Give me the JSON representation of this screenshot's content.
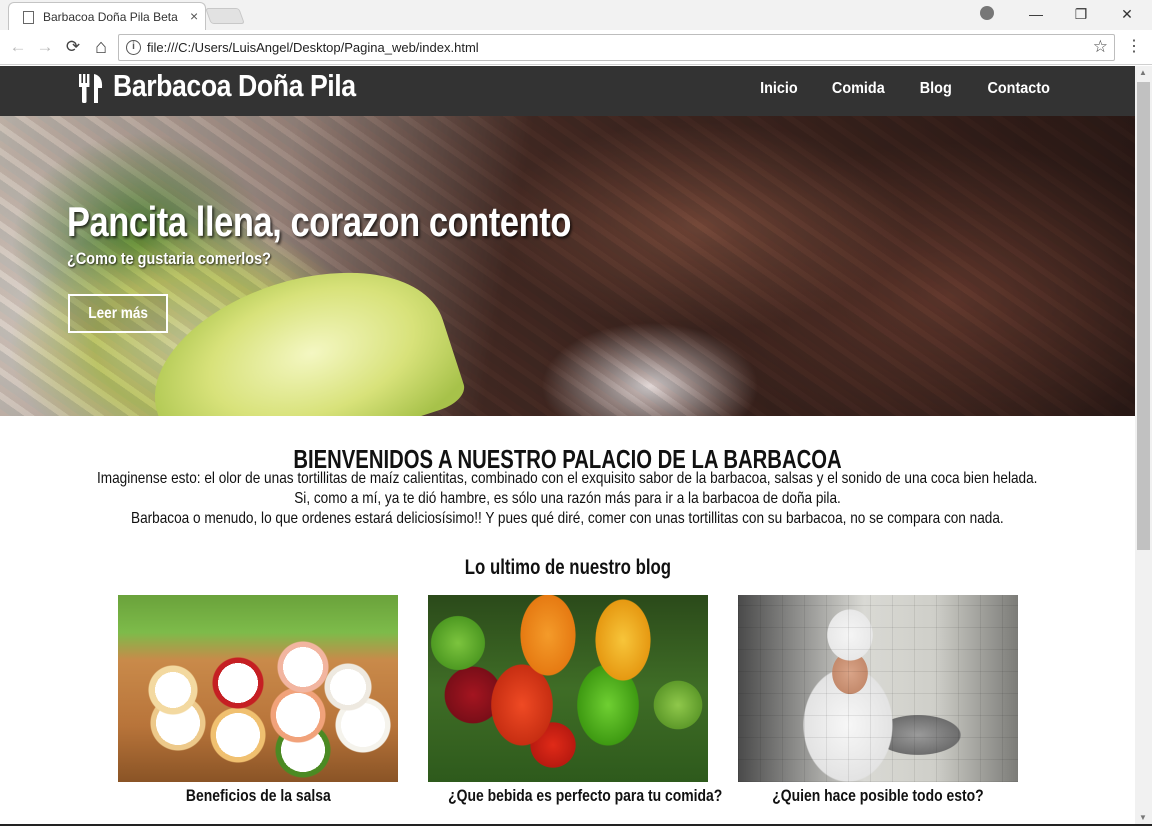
{
  "browser": {
    "tab_title": "Barbacoa Doña Pila Beta",
    "tab_close": "×",
    "url": "file:///C:/Users/LuisAngel/Desktop/Pagina_web/index.html",
    "back": "←",
    "forward": "→",
    "reload": "⟳",
    "home": "⌂",
    "info": "i",
    "star": "☆",
    "menu": "⋮",
    "minimize": "—",
    "restore": "❐",
    "close": "✕"
  },
  "site": {
    "logo": "Barbacoa Doña Pila",
    "nav": [
      "Inicio",
      "Comida",
      "Blog",
      "Contacto"
    ]
  },
  "hero": {
    "title": "Pancita llena, corazon contento",
    "subtitle": "¿Como te gustaria comerlos?",
    "button": "Leer más"
  },
  "welcome": {
    "title": "BIENVENIDOS A NUESTRO PALACIO DE LA BARBACOA",
    "lines": [
      "Imaginense esto: el olor de unas tortillitas de maíz calientitas, combinado con el exquisito sabor de la barbacoa, salsas y el sonido de una coca bien helada.",
      "Si, como a mí, ya te dió hambre, es sólo una razón más para ir a la barbacoa de doña pila.",
      "Barbacoa o menudo, lo que ordenes estará deliciosísimo!! Y pues qué diré, comer con unas tortillitas con su barbacoa, no se compara con nada."
    ]
  },
  "blog": {
    "heading": "Lo ultimo de nuestro blog",
    "posts": [
      {
        "title": "Beneficios de la salsa"
      },
      {
        "title": "¿Que bebida es perfecto para tu comida?"
      },
      {
        "title": "¿Quien hace posible todo esto?"
      }
    ]
  },
  "colors": {
    "header_bg": "#333333",
    "tab_bg": "#f2f2f2",
    "text": "#111111"
  }
}
